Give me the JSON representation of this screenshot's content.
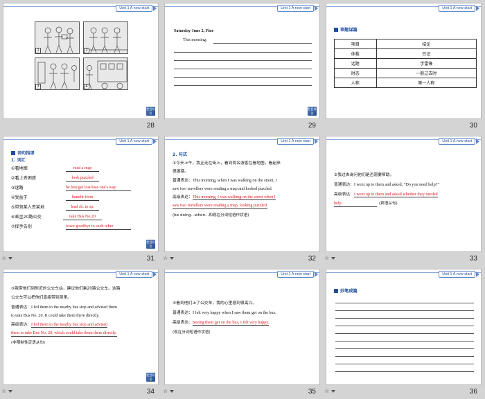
{
  "header": {
    "unit_label": "Unit 1  A new start",
    "corner_label": "栏目导引"
  },
  "slides": {
    "s28": {
      "page": "28",
      "panels": [
        "1",
        "2",
        "3",
        "4"
      ]
    },
    "s29": {
      "page": "29",
      "date_line": "Saturday    June 2, Fine",
      "opening": "This morning,"
    },
    "s30": {
      "page": "30",
      "section": "审题谋篇",
      "table": [
        [
          "项目",
          "结论"
        ],
        [
          "体裁",
          "日记"
        ],
        [
          "话题",
          "学雷锋"
        ],
        [
          "时态",
          "一般过去时"
        ],
        [
          "人称",
          "第一人称"
        ]
      ]
    },
    "s31": {
      "page": "31",
      "section": "词句指津",
      "subhead": "1.  词汇",
      "items": [
        {
          "cn": "①看地图",
          "en": "read a map"
        },
        {
          "cn": "②看上去困惑",
          "en": "look puzzled"
        },
        {
          "cn": "③迷路",
          "en": "be lost/get lost/lose one's way"
        },
        {
          "cn": "④受益于",
          "en": "benefit from"
        },
        {
          "cn": "⑤带领某人去某地",
          "en": "lead sb. to sp."
        },
        {
          "cn": "⑥乘坐20路公交",
          "en": "take Bus No.20"
        },
        {
          "cn": "⑦挥手告别",
          "en": "wave goodbye to each other"
        }
      ]
    },
    "s32": {
      "page": "32",
      "subhead": "2.  句式",
      "q1": "①今天上午，我正走在街上，看到两名游客在看地图，看起来",
      "q2": "很困惑。",
      "plain_label": "普通表达：",
      "plain1": "This morning, when I was walking on the street, I",
      "plain2": "saw two travellers were reading a map and looked puzzled.",
      "adv_label": "高级表达：",
      "adv1": "This morning, I was walking on the street when I",
      "adv2": "saw two travellers were reading a map, looking puzzled.",
      "note": "(be doing...when...和现在分词短语作状语)"
    },
    "s33": {
      "page": "33",
      "q1": "②我过去询问他们是否需要帮助。",
      "plain_label": "普通表达：",
      "plain": "I went up to them and asked, “Do you need help?”",
      "adv_label": "高级表达：",
      "adv1": "I went up to them and asked whether they needed",
      "adv2": "help.",
      "note": "(宾语从句)"
    },
    "s34": {
      "page": "34",
      "q1": "③我带他们到附近的公交车站，建议他们乘20路公交车。这路",
      "q2": "公交车可以把他们直接带到那里。",
      "plain_label": "普通表达：",
      "plain1": "I led them to the nearby bus stop and advised them",
      "plain2": "to take Bus No. 20. It could take them there directly.",
      "adv_label": "高级表达：",
      "adv1": "I led them to the nearby bus stop and advised",
      "adv2": "them to take Bus No. 20, which could take them there directly.",
      "note": "(非限制性定语从句)"
    },
    "s35": {
      "page": "35",
      "q1": "④看到他们上了公交车，我的心里感到很高兴。",
      "plain_label": "普通表达：",
      "plain": "I felt very happy when I saw them get on the bus.",
      "adv_label": "高级表达：",
      "adv": "Seeing them get on the bus, I felt very happy.",
      "note": "(现在分词短语作状语)"
    },
    "s36": {
      "page": "36",
      "section": "妙笔成篇"
    }
  }
}
